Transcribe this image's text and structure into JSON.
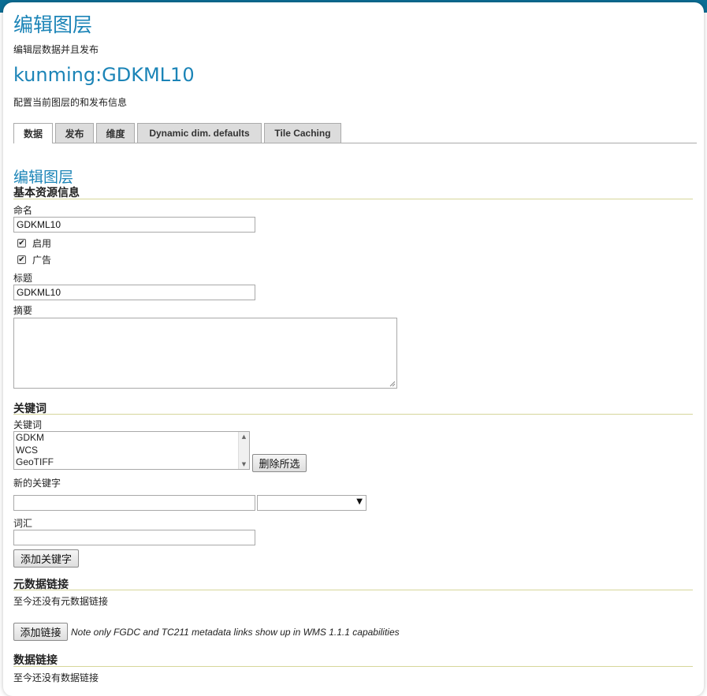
{
  "header": {
    "title": "编辑图层",
    "subtitle": "编辑层数据并且发布",
    "layer_name": "kunming:GDKML10",
    "layer_desc": "配置当前图层的和发布信息"
  },
  "tabs": [
    {
      "label": "数据",
      "active": true
    },
    {
      "label": "发布",
      "active": false
    },
    {
      "label": "维度",
      "active": false
    },
    {
      "label": "Dynamic dim. defaults",
      "active": false
    },
    {
      "label": "Tile Caching",
      "active": false
    }
  ],
  "form": {
    "heading": "编辑图层",
    "basic": {
      "title": "基本资源信息",
      "name_label": "命名",
      "name_value": "GDKML10",
      "enabled_label": "启用",
      "enabled": true,
      "advertised_label": "广告",
      "advertised": true,
      "title_label": "标题",
      "title_value": "GDKML10",
      "abstract_label": "摘要",
      "abstract_value": ""
    },
    "keywords": {
      "title": "关键词",
      "list_label": "关键词",
      "items": [
        "GDKM",
        "WCS",
        "GeoTIFF"
      ],
      "remove_button": "删除所选",
      "new_label": "新的关键字",
      "new_value": "",
      "language_value": "",
      "vocab_label": "词汇",
      "vocab_value": "",
      "add_button": "添加关键字"
    },
    "metadata_links": {
      "title": "元数据链接",
      "empty_text": "至今还没有元数据链接",
      "add_button": "添加链接",
      "note": "Note only FGDC and TC211 metadata links show up in WMS 1.1.1 capabilities"
    },
    "data_links": {
      "title": "数据链接",
      "empty_text": "至今还没有数据链接"
    }
  },
  "colors": {
    "header_bar": "#0b6e95",
    "title_blue": "#1b84b7",
    "section_rule": "#d6d69a"
  }
}
